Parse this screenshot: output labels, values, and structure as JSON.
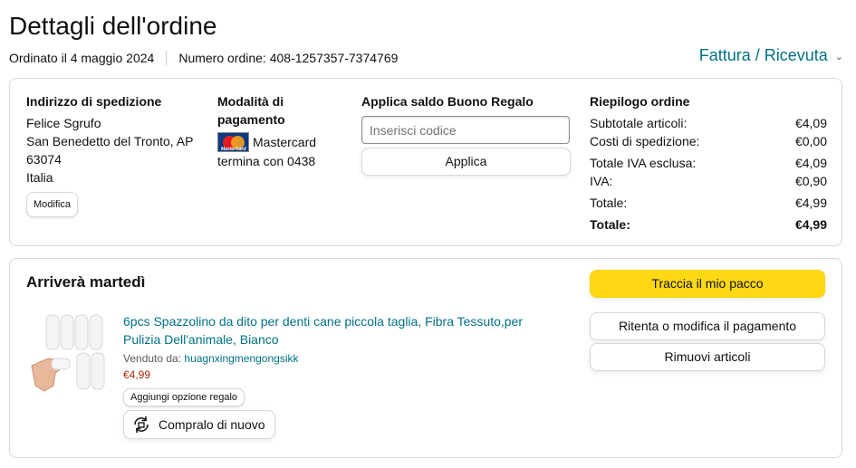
{
  "header": {
    "title": "Dettagli dell'ordine",
    "ordered_on": "Ordinato il 4 maggio 2024",
    "order_number": "Numero ordine: 408-1257357-7374769",
    "invoice_link": "Fattura / Ricevuta"
  },
  "shipping": {
    "heading": "Indirizzo di spedizione",
    "name": "Felice Sgrufo",
    "city": "San Benedetto del Tronto, AP",
    "zip": "63074",
    "country": "Italia",
    "edit_label": "Modifica"
  },
  "payment": {
    "heading": "Modalità di pagamento",
    "card_name": "Mastercard",
    "card_ending": "termina con 0438",
    "logo_text": "MasterCard"
  },
  "gift_card": {
    "heading": "Applica saldo Buono Regalo",
    "placeholder": "Inserisci codice",
    "apply_label": "Applica"
  },
  "summary": {
    "heading": "Riepilogo ordine",
    "rows": [
      {
        "label": "Subtotale articoli:",
        "value": "€4,09"
      },
      {
        "label": "Costi di spedizione:",
        "value": "€0,00"
      },
      {
        "label": "Totale IVA esclusa:",
        "value": "€4,09"
      },
      {
        "label": "IVA:",
        "value": "€0,90"
      },
      {
        "label": "Totale:",
        "value": "€4,99"
      },
      {
        "label": "Totale:",
        "value": "€4,99"
      }
    ]
  },
  "shipment": {
    "status": "Arriverà martedì",
    "product_title": "6pcs Spazzolino da dito per denti cane piccola taglia, Fibra Tessuto,per Pulizia Dell'animale, Bianco",
    "sold_by_label": "Venduto da:",
    "seller": "huagnxingmengongsikk",
    "price": "€4,99",
    "gift_option_label": "Aggiungi opzione regalo",
    "buy_again_label": "Compralo di nuovo"
  },
  "actions": {
    "track": "Traccia il mio pacco",
    "retry_payment": "Ritenta o modifica il pagamento",
    "remove_items": "Rimuovi articoli"
  },
  "colors": {
    "link": "#007185",
    "price": "#b12704",
    "primary_button": "#ffd814",
    "border": "#d5d9d9"
  },
  "icons": {
    "invoice_chevron": "chevron-down-icon",
    "buy_again": "buy-again-icon",
    "card_logo": "mastercard-logo"
  }
}
